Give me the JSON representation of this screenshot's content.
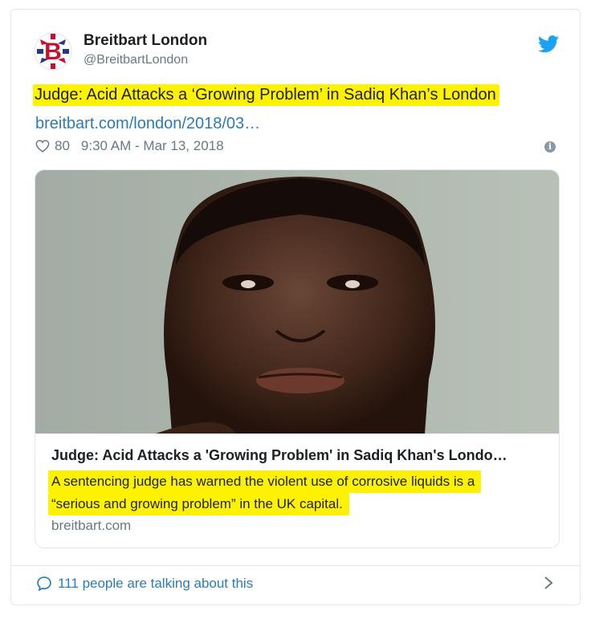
{
  "author": {
    "name": "Breitbart London",
    "handle": "@BreitbartLondon",
    "logo_letter": "B"
  },
  "tweet": {
    "text": "Judge: Acid Attacks a ‘Growing Problem’ in Sadiq Khan’s London",
    "link": "breitbart.com/london/2018/03…",
    "likes": "80",
    "timestamp": "9:30 AM - Mar 13, 2018"
  },
  "preview": {
    "title": "Judge: Acid Attacks a 'Growing Problem' in Sadiq Khan's Londo…",
    "description_line1": "A sentencing judge has warned the violent use of corrosive liquids is a",
    "description_line2": "“serious and growing problem” in the UK capital.",
    "domain": "breitbart.com"
  },
  "footer": {
    "talking": "111 people are talking about this"
  },
  "colors": {
    "link": "#2b7bb9",
    "highlight": "#fff200",
    "muted": "#697882",
    "border": "#e1e8ed"
  },
  "icons": {
    "brand": "twitter-bird-icon",
    "like": "heart-icon",
    "reply": "speech-bubble-icon",
    "more": "chevron-right-icon",
    "info": "info-icon"
  }
}
